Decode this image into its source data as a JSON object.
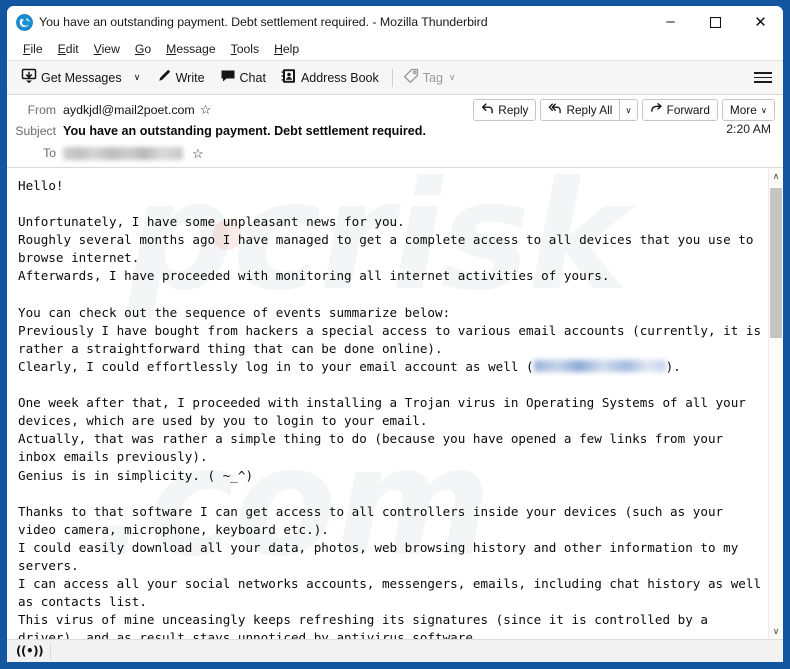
{
  "window": {
    "title": "You have an outstanding payment. Debt settlement required. - Mozilla Thunderbird",
    "app_icon": "thunderbird-icon",
    "controls": {
      "minimize": "–",
      "maximize": "□",
      "close": "✕"
    }
  },
  "menubar": {
    "items": [
      {
        "label": "File"
      },
      {
        "label": "Edit"
      },
      {
        "label": "View"
      },
      {
        "label": "Go"
      },
      {
        "label": "Message"
      },
      {
        "label": "Tools"
      },
      {
        "label": "Help"
      }
    ]
  },
  "toolbar": {
    "get_messages": "Get Messages",
    "get_messages_caret": "∨",
    "write": "Write",
    "chat": "Chat",
    "address_book": "Address Book",
    "tag": "Tag",
    "tag_caret": "∨",
    "tag_disabled": true,
    "app_menu": "hamburger-menu"
  },
  "message_header": {
    "from_label": "From",
    "from_value": "aydkjdl@mail2poet.com",
    "from_star": "☆",
    "subject_label": "Subject",
    "subject_value": "You have an outstanding payment. Debt settlement required.",
    "to_label": "To",
    "to_value_redacted": true,
    "to_star": "☆",
    "time": "2:20 AM",
    "actions": {
      "reply": "Reply",
      "reply_all": "Reply All",
      "reply_all_caret": "∨",
      "forward": "Forward",
      "more": "More",
      "more_caret": "∨"
    }
  },
  "message_body": {
    "part1": "Hello!\n\nUnfortunately, I have some unpleasant news for you.\nRoughly several months ago I have managed to get a complete access to all devices that you use to browse internet.\nAfterwards, I have proceeded with monitoring all internet activities of yours.\n\nYou can check out the sequence of events summarize below:\nPreviously I have bought from hackers a special access to various email accounts (currently, it is rather a straightforward thing that can be done online).\nClearly, I could effortlessly log in to your email account as well (",
    "part2": ").\n\nOne week after that, I proceeded with installing a Trojan virus in Operating Systems of all your devices, which are used by you to login to your email.\nActually, that was rather a simple thing to do (because you have opened a few links from your inbox emails previously).\nGenius is in simplicity. ( ~_^)\n\nThanks to that software I can get access to all controllers inside your devices (such as your video camera, microphone, keyboard etc.).\nI could easily download all your data, photos, web browsing history and other information to my servers.\nI can access all your social networks accounts, messengers, emails, including chat history as well as contacts list.\nThis virus of mine unceasingly keeps refreshing its signatures (since it is controlled by a driver), and as result stays unnoticed by antivirus software.",
    "watermark_line1": "pcrisk",
    "watermark_line2": ".com"
  },
  "scrollbar": {
    "up_arrow": "∧",
    "down_arrow": "∨"
  },
  "statusbar": {
    "icon": "((•))",
    "text": ""
  },
  "colors": {
    "window_frame": "#1256a0",
    "toolbar_bg": "#f6f6f6",
    "body_bg": "#ffffff",
    "accent": "#0d5296"
  }
}
